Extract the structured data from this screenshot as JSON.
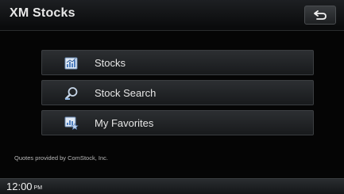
{
  "header": {
    "title": "XM Stocks",
    "back_icon": "back-arrow-icon"
  },
  "menu": {
    "items": [
      {
        "label": "Stocks",
        "icon": "stocks-chart-icon"
      },
      {
        "label": "Stock Search",
        "icon": "magnifier-icon"
      },
      {
        "label": "My Favorites",
        "icon": "favorites-star-icon"
      }
    ]
  },
  "footer": {
    "note": "Quotes provided by ComStock, Inc."
  },
  "status_bar": {
    "time": "12:00",
    "period": "PM"
  },
  "colors": {
    "background": "#050505",
    "button_face": "#2c2f32",
    "text": "#e6e6e6",
    "icon_blue": "#8fb4e0"
  }
}
